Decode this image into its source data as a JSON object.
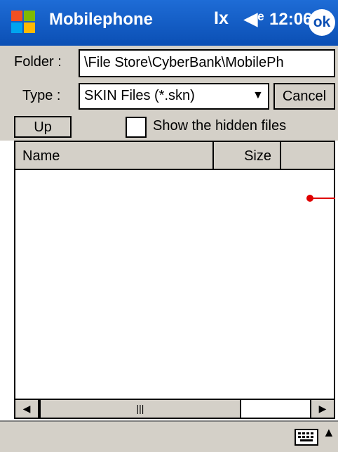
{
  "titlebar": {
    "title": "Mobilephone",
    "time": "12:06",
    "ok_label": "ok",
    "icons": [
      "windows-start-icon",
      "connectivity-icon",
      "volume-icon"
    ]
  },
  "form": {
    "folder_label": "Folder :",
    "folder_value": "\\File Store\\CyberBank\\MobilePh",
    "type_label": "Type :",
    "type_value": "SKIN Files (*.skn)",
    "cancel_label": "Cancel",
    "up_label": "Up",
    "hidden_files_label": "Show the hidden files",
    "hidden_files_checked": false
  },
  "list": {
    "columns": [
      "Name",
      "Size"
    ],
    "rows": []
  },
  "colors": {
    "titlebar": "#0b4fb4",
    "chrome": "#d4d0c8",
    "marker": "#e00000"
  }
}
